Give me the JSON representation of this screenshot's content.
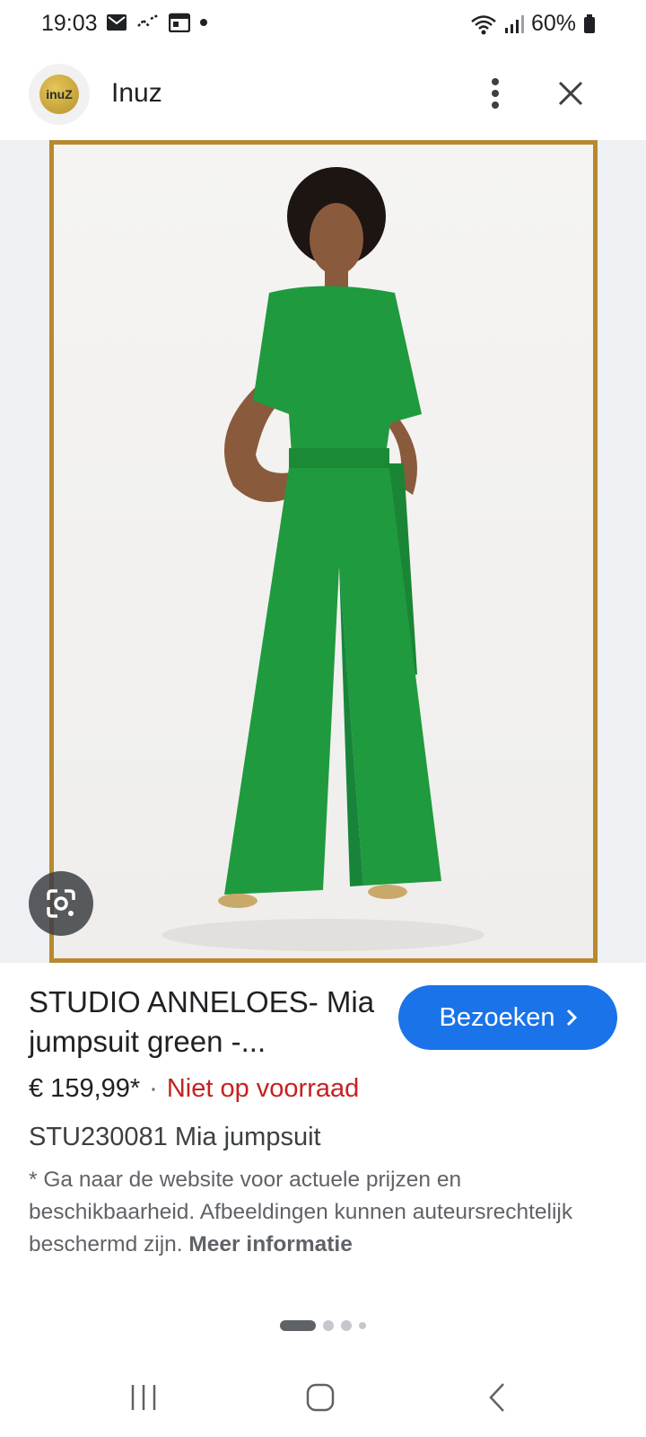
{
  "status_bar": {
    "time": "19:03",
    "battery": "60%"
  },
  "header": {
    "logo_text": "inuZ",
    "site_name": "Inuz"
  },
  "product": {
    "image_alt": "Woman wearing a green wrap jumpsuit with wide legs",
    "title": "STUDIO ANNELOES- Mia jumpsuit green -...",
    "visit_label": "Bezoeken",
    "price": "€ 159,99*",
    "separator": "·",
    "stock_status": "Niet op voorraad",
    "sku": "STU230081 Mia jumpsuit",
    "disclaimer": "* Ga naar de website voor actuele prijzen en beschikbaarheid. Afbeeldingen kunnen auteursrechtelijk beschermd zijn.",
    "more_info": "Meer informatie"
  },
  "colors": {
    "accent": "#1a73e8",
    "stock_red": "#c5221f",
    "image_border": "#b8892e",
    "jumpsuit_green": "#1f9a3e"
  },
  "icons": {
    "menu": "more-vert-icon",
    "close": "close-icon",
    "lens": "google-lens-icon",
    "chevron": "chevron-right-icon"
  }
}
